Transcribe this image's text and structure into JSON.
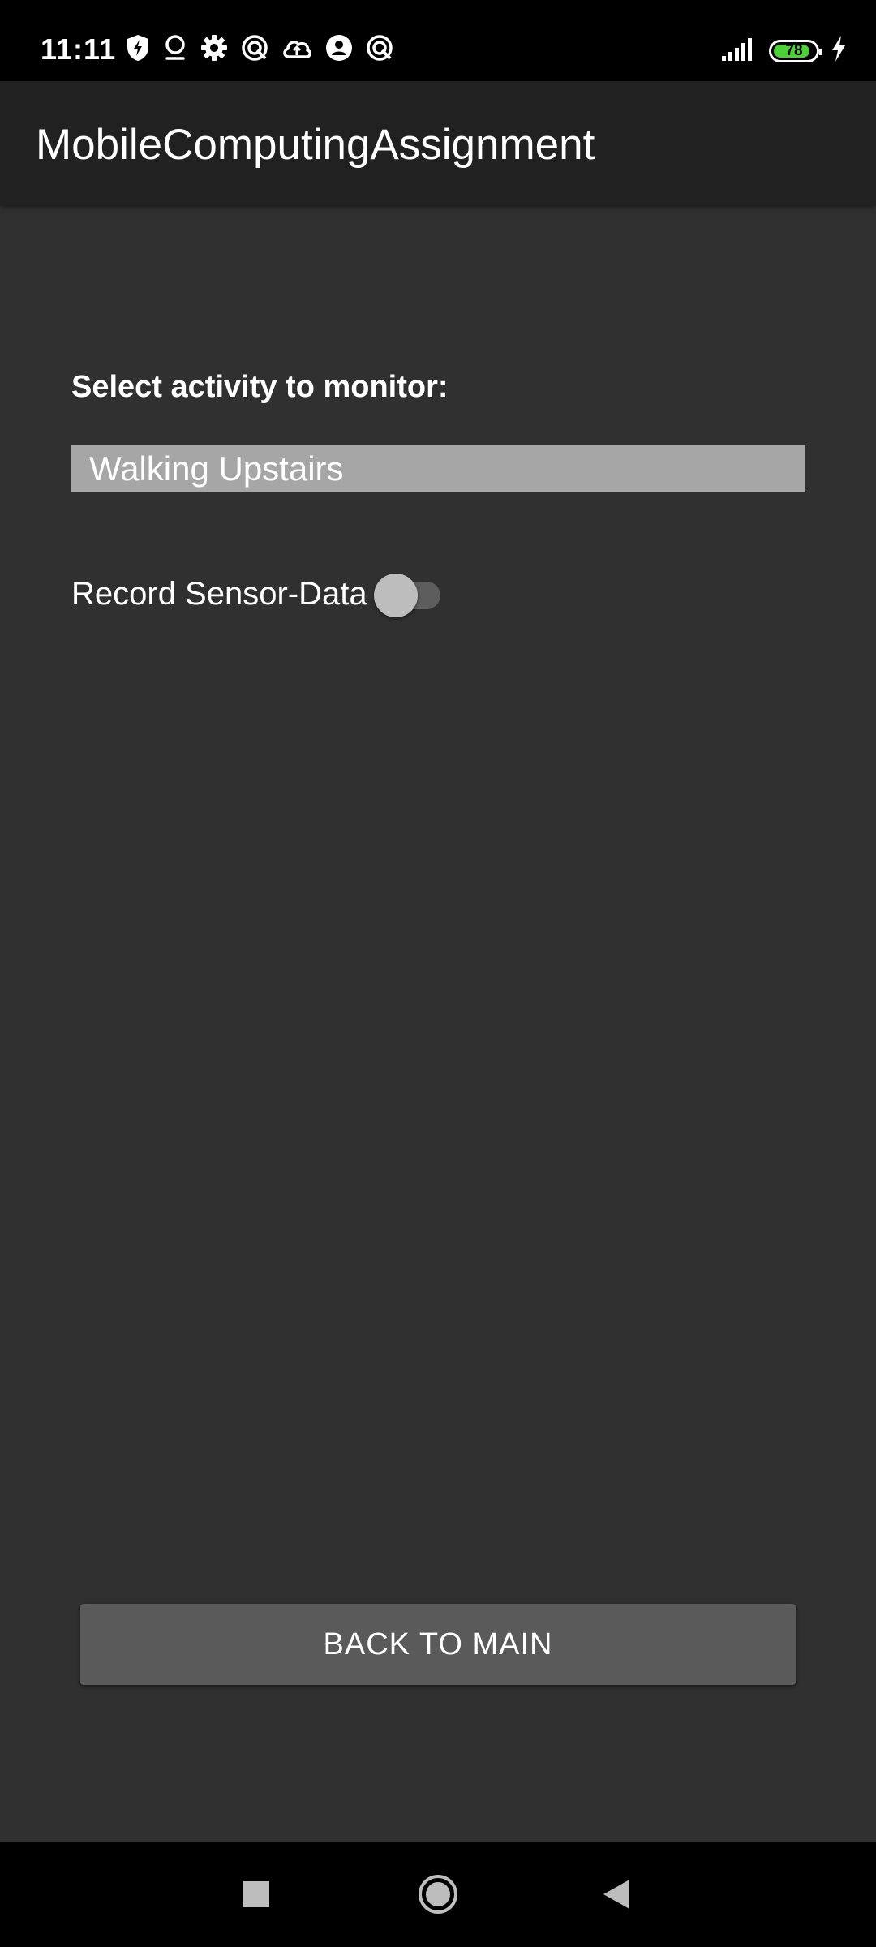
{
  "status_bar": {
    "time": "11:11",
    "notification_icons": [
      "shield-bolt-icon",
      "location-pin-icon",
      "gear-icon",
      "sync-icon",
      "cloud-upload-icon",
      "account-icon",
      "sync-icon"
    ],
    "battery_level": "78",
    "charging": true
  },
  "app_bar": {
    "title": "MobileComputingAssignment"
  },
  "content": {
    "select_label": "Select activity to monitor:",
    "selected_activity": "Walking Upstairs",
    "record_label": "Record Sensor-Data",
    "record_enabled": false
  },
  "footer": {
    "back_button_label": "BACK TO MAIN"
  },
  "nav_bar": {
    "buttons": [
      "recents-square-icon",
      "home-circle-icon",
      "back-triangle-icon"
    ]
  },
  "colors": {
    "background": "#303030",
    "app_bar": "#212121",
    "spinner": "#a6a6a6",
    "button": "#5a5a5a",
    "battery": "#4cd137"
  }
}
